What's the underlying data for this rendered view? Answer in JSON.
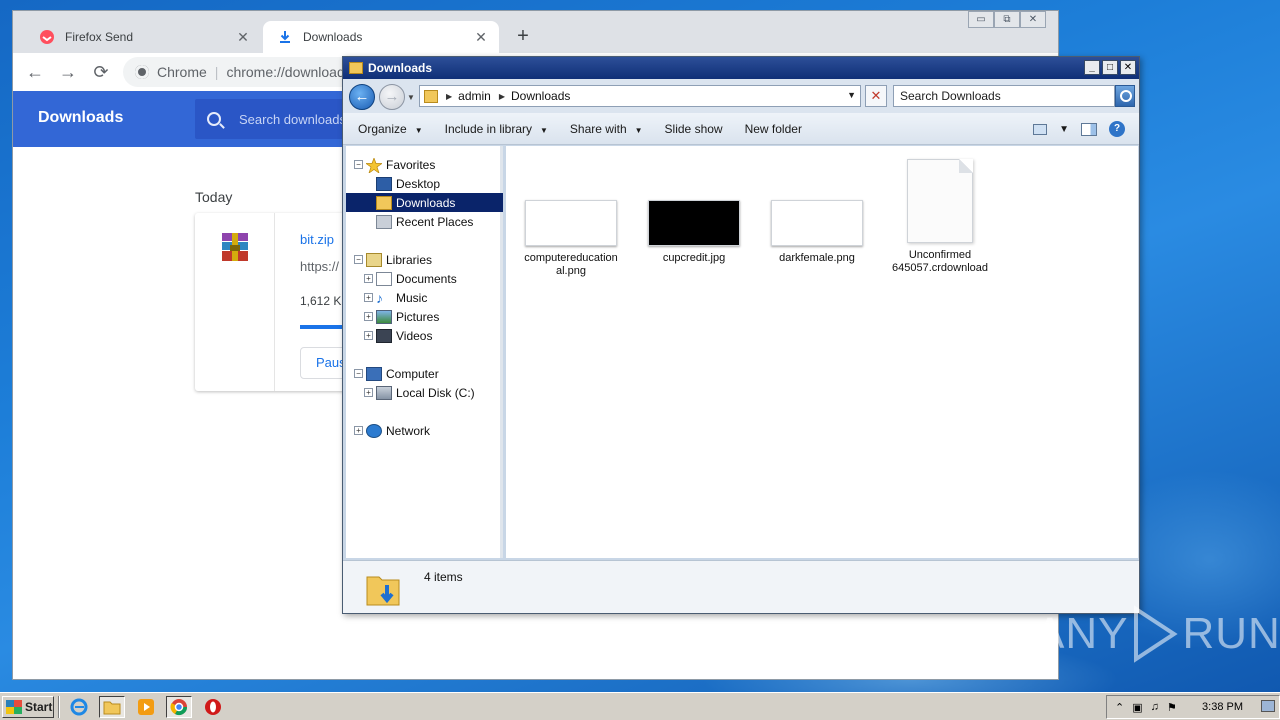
{
  "chrome": {
    "tabs": [
      {
        "label": "Firefox Send"
      },
      {
        "label": "Downloads"
      }
    ],
    "new_tab": "+",
    "window_controls": {
      "minimize": "▭",
      "restore": "⧉",
      "close": "✕"
    },
    "omnibox": {
      "site": "Chrome",
      "separator": "|",
      "url": "chrome://downloads"
    },
    "page": {
      "title": "Downloads",
      "search_placeholder": "Search downloads",
      "section": "Today",
      "download": {
        "filename": "bit.zip",
        "url": "https://",
        "size": "1,612 K",
        "progress_percent": 40,
        "pause_label": "Pause"
      }
    }
  },
  "explorer": {
    "title": "Downloads",
    "address": {
      "crumbs": [
        "admin",
        "Downloads"
      ]
    },
    "search_placeholder": "Search Downloads",
    "commands": [
      {
        "label": "Organize",
        "dropdown": "▼"
      },
      {
        "label": "Include in library",
        "dropdown": "▼"
      },
      {
        "label": "Share with",
        "dropdown": "▼"
      },
      {
        "label": "Slide show"
      },
      {
        "label": "New folder"
      }
    ],
    "nav": {
      "favorites": "Favorites",
      "desktop": "Desktop",
      "downloads": "Downloads",
      "recent_places": "Recent Places",
      "libraries": "Libraries",
      "documents": "Documents",
      "music": "Music",
      "pictures": "Pictures",
      "videos": "Videos",
      "computer": "Computer",
      "local_disk": "Local Disk (C:)",
      "network": "Network"
    },
    "files": [
      {
        "name_line1": "computereducation",
        "name_line2": "al.png"
      },
      {
        "name_line1": "cupcredit.jpg",
        "name_line2": ""
      },
      {
        "name_line1": "darkfemale.png",
        "name_line2": ""
      },
      {
        "name_line1": "Unconfirmed",
        "name_line2": "645057.crdownload"
      }
    ],
    "status": "4 items"
  },
  "taskbar": {
    "start_label": "Start",
    "clock": "3:38 PM"
  },
  "watermark": {
    "left": "ANY",
    "right": "RUN"
  },
  "colors": {
    "chrome_header": "#3367d6",
    "explorer_title": "#0f2f77",
    "selection": "#0a246a"
  }
}
